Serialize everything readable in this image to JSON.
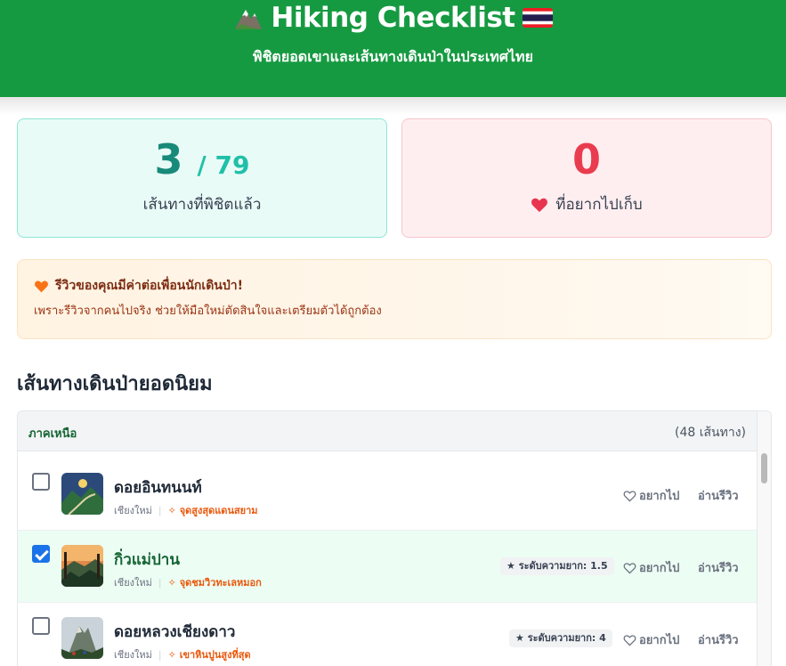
{
  "header": {
    "title": "Hiking Checklist",
    "subtitle": "พิชิตยอดเขาและเส้นทางเดินป่าในประเทศไทย"
  },
  "stats": {
    "done_count": "3",
    "done_total": "/ 79",
    "done_label": "เส้นทางที่พิชิตแล้ว",
    "wish_count": "0",
    "wish_label": "ที่อยากไปเก็บ"
  },
  "notice": {
    "title": "รีวิวของคุณมีค่าต่อเพื่อนนักเดินป่า!",
    "body": "เพราะรีวิวจากคนไปจริง ช่วยให้มือใหม่ตัดสินใจและเตรียมตัวได้ถูกต้อง"
  },
  "section_title": "เส้นทางเดินป่ายอดนิยม",
  "region": {
    "name": "ภาคเหนือ",
    "count": "(48 เส้นทาง)"
  },
  "trails": [
    {
      "name": "ดอยอินทนนท์",
      "province": "เชียงใหม่",
      "highlight": "จุดสูงสุดแดนสยาม",
      "difficulty": "",
      "checked": false,
      "want_label": "อยากไป",
      "review_label": "อ่านรีวิว"
    },
    {
      "name": "กิ่วแม่ปาน",
      "province": "เชียงใหม่",
      "highlight": "จุดชมวิวทะเลหมอก",
      "difficulty": "ระดับความยาก: 1.5",
      "checked": true,
      "want_label": "อยากไป",
      "review_label": "อ่านรีวิว"
    },
    {
      "name": "ดอยหลวงเชียงดาว",
      "province": "เชียงใหม่",
      "highlight": "เขาหินปูนสูงที่สุด",
      "difficulty": "ระดับความยาก: 4",
      "checked": false,
      "want_label": "อยากไป",
      "review_label": "อ่านรีวิว"
    }
  ],
  "colors": {
    "header": "#169a41",
    "accent_teal": "#188a7a",
    "accent_red": "#ea3c4f",
    "highlight_orange": "#ea580c"
  },
  "icons": {
    "title_left": "mountain-icon",
    "title_right": "thai-flag-icon",
    "wish": "heart-icon",
    "notice": "orange-heart-icon",
    "highlight": "sparkle-icon",
    "difficulty": "star-icon",
    "want": "heart-outline-icon"
  }
}
